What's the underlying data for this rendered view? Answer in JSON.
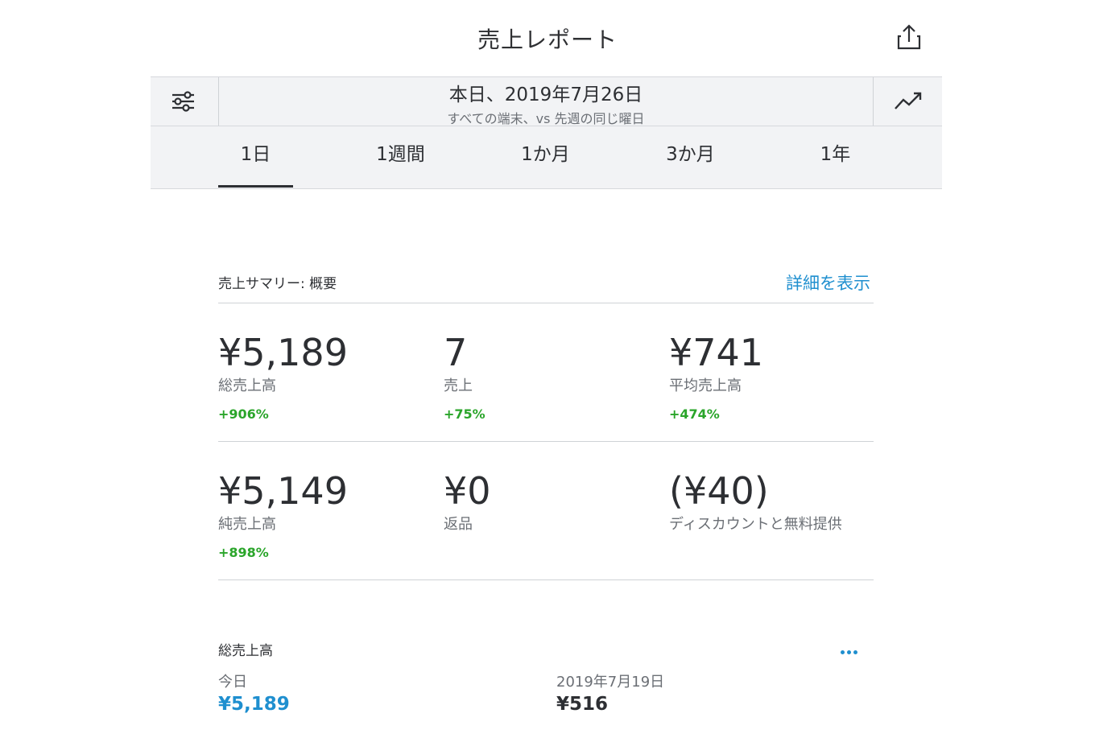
{
  "header": {
    "title": "売上レポート"
  },
  "date_selector": {
    "date_label": "本日、2019年7月26日",
    "subtitle": "すべての端末、vs 先週の同じ曜日"
  },
  "tabs": [
    {
      "label": "1日",
      "active": true
    },
    {
      "label": "1週間",
      "active": false
    },
    {
      "label": "1か月",
      "active": false
    },
    {
      "label": "3か月",
      "active": false
    },
    {
      "label": "1年",
      "active": false
    }
  ],
  "summary": {
    "title": "売上サマリー: 概要",
    "detail_link": "詳細を表示",
    "row1": [
      {
        "value": "¥5,189",
        "label": "総売上高",
        "change": "+906%"
      },
      {
        "value": "7",
        "label": "売上",
        "change": "+75%"
      },
      {
        "value": "¥741",
        "label": "平均売上高",
        "change": "+474%"
      }
    ],
    "row2": [
      {
        "value": "¥5,149",
        "label": "純売上高",
        "change": "+898%"
      },
      {
        "value": "¥0",
        "label": "返品",
        "change": ""
      },
      {
        "value": "(¥40)",
        "label": "ディスカウントと無料提供",
        "change": ""
      }
    ]
  },
  "gross_sales": {
    "title": "総売上高",
    "today_label": "今日",
    "today_value": "¥5,189",
    "compare_label": "2019年7月19日",
    "compare_value": "¥516"
  },
  "colors": {
    "accent": "#1f8fcf",
    "positive": "#2aa52a",
    "panel_bg": "#f2f3f5",
    "text": "#2d2f33",
    "muted": "#6b6f75"
  },
  "icons": {
    "share": "share-icon",
    "filter": "sliders-icon",
    "trend": "trend-up-icon",
    "more": "more-dots-icon"
  }
}
